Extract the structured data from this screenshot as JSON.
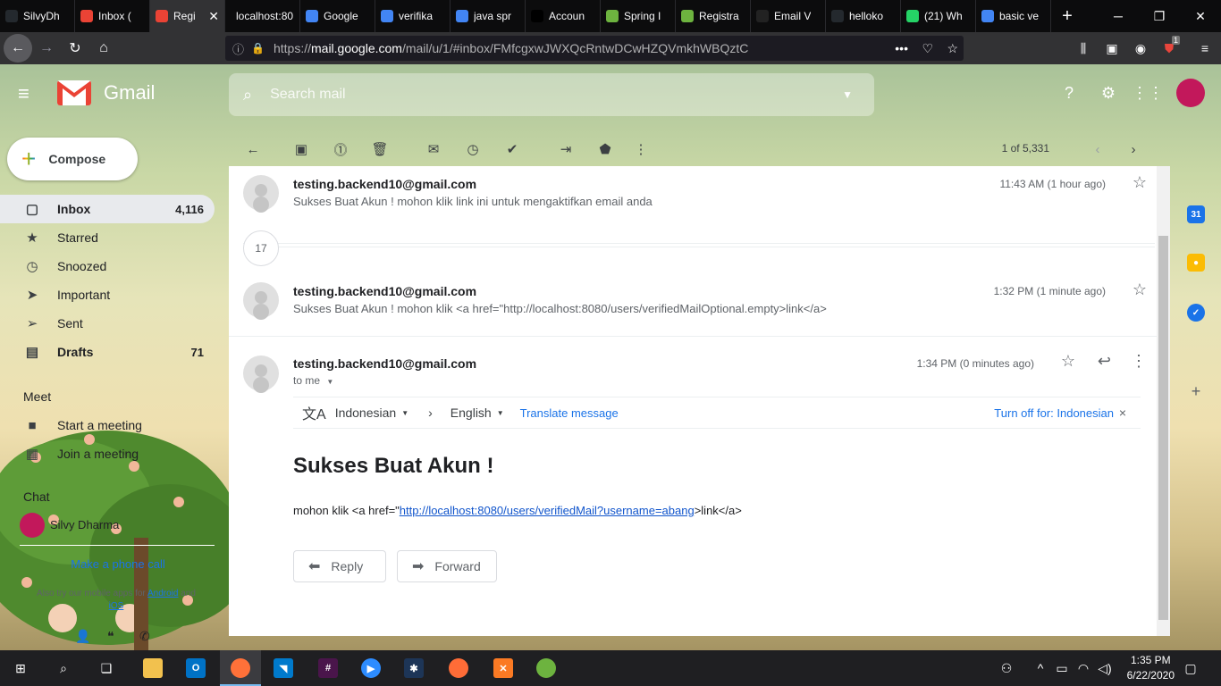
{
  "browser": {
    "tabs": [
      {
        "label": "SilvyDh",
        "icon": "github-icon",
        "color": "#24292e"
      },
      {
        "label": "Inbox (",
        "icon": "gmail-icon",
        "color": "#ea4335"
      },
      {
        "label": "Regi",
        "icon": "gmail-icon",
        "color": "#ea4335",
        "active": true,
        "close": "✕"
      },
      {
        "label": "localhost:80",
        "icon": "",
        "color": ""
      },
      {
        "label": "Google",
        "icon": "google-icon",
        "color": "#4285f4"
      },
      {
        "label": "verifika",
        "icon": "google-icon",
        "color": "#4285f4"
      },
      {
        "label": "java spr",
        "icon": "google-icon",
        "color": "#4285f4"
      },
      {
        "label": "Accoun",
        "icon": "medium-icon",
        "color": "#000000"
      },
      {
        "label": "Spring I",
        "icon": "spring-icon",
        "color": "#6db33f"
      },
      {
        "label": "Registra",
        "icon": "spring-icon",
        "color": "#6db33f"
      },
      {
        "label": "Email V",
        "icon": "k-icon",
        "color": "#222222"
      },
      {
        "label": "helloko",
        "icon": "github-icon",
        "color": "#24292e"
      },
      {
        "label": "(21) Wh",
        "icon": "whatsapp-icon",
        "color": "#25d366"
      },
      {
        "label": "basic ve",
        "icon": "google-icon",
        "color": "#4285f4"
      }
    ],
    "new_tab": "+",
    "url_prefix": "https://",
    "url_host": "mail.google.com",
    "url_path": "/mail/u/1/#inbox/FMfcgxwJWXQcRntwDCwHZQVmkhWBQztC",
    "page_actions": "•••",
    "extension_badge": "1"
  },
  "gmail": {
    "logo_text": "Gmail",
    "search_placeholder": "Search mail",
    "compose_label": "Compose",
    "compose_plus": "+",
    "nav": [
      {
        "label": "Inbox",
        "count": "4,116",
        "icon": "inbox-icon",
        "glyph": "▢"
      },
      {
        "label": "Starred",
        "count": "",
        "icon": "star-icon",
        "glyph": "★"
      },
      {
        "label": "Snoozed",
        "count": "",
        "icon": "clock-icon",
        "glyph": "◷"
      },
      {
        "label": "Important",
        "count": "",
        "icon": "important-icon",
        "glyph": "➤"
      },
      {
        "label": "Sent",
        "count": "",
        "icon": "send-icon",
        "glyph": "➢"
      },
      {
        "label": "Drafts",
        "count": "71",
        "icon": "draft-icon",
        "glyph": "▤"
      }
    ],
    "meet_title": "Meet",
    "meet_items": [
      {
        "label": "Start a meeting",
        "icon": "video-icon",
        "glyph": "■"
      },
      {
        "label": "Join a meeting",
        "icon": "keyboard-icon",
        "glyph": "▦"
      }
    ],
    "chat_title": "Chat",
    "chat_user": "Silvy Dharma",
    "phone_call": "Make a phone call",
    "also_try_pre": "Also try our mobile apps for",
    "android": "Android",
    "and": "and",
    "ios": "iOS",
    "pager": "1 of 5,331",
    "collapsed_count": "17",
    "messages": [
      {
        "sender": "testing.backend10@gmail.com",
        "snippet": "Sukses Buat Akun ! mohon klik link ini untuk mengaktifkan email anda",
        "time": "11:43 AM (1 hour ago)"
      },
      {
        "sender": "testing.backend10@gmail.com",
        "snippet": "Sukses Buat Akun ! mohon klik <a href=\"http://localhost:8080/users/verifiedMailOptional.empty>link</a>",
        "time": "1:32 PM (1 minute ago)"
      },
      {
        "sender": "testing.backend10@gmail.com",
        "to": "to me",
        "time": "1:34 PM (0 minutes ago)"
      }
    ],
    "translate": {
      "from": "Indonesian",
      "to": "English",
      "action": "Translate message",
      "turn_off": "Turn off for: Indonesian",
      "close": "×"
    },
    "subject": "Sukses Buat Akun !",
    "body_pre": "mohon klik <a href=\"",
    "body_link": "http://localhost:8080/users/verifiedMail?username=abang",
    "body_post": ">link</a>",
    "reply_label": "Reply",
    "forward_label": "Forward"
  },
  "taskbar": {
    "time": "1:35 PM",
    "date": "6/22/2020"
  },
  "colors": {
    "accent_blue": "#1a73e8",
    "gmail_red": "#ea4335",
    "browser_dark": "#0c0c0d"
  }
}
